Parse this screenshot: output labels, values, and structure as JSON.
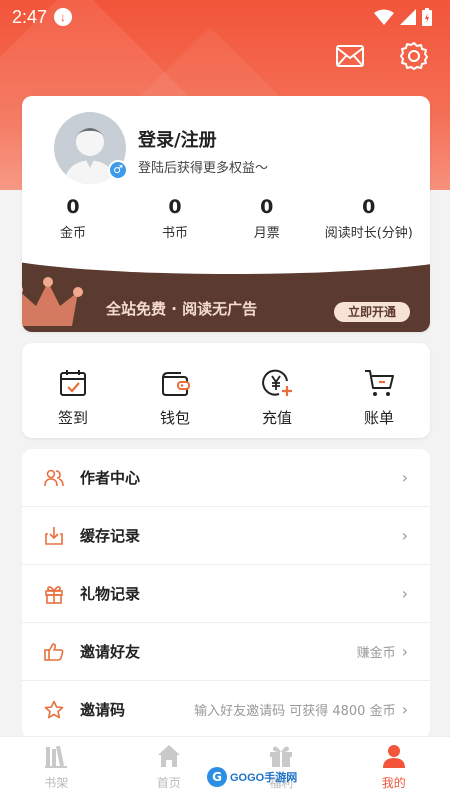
{
  "status_bar": {
    "time": "2:47"
  },
  "profile": {
    "login_title": "登录/注册",
    "login_subtitle": "登陆后获得更多权益～",
    "stats": [
      {
        "value": "0",
        "label": "金币"
      },
      {
        "value": "0",
        "label": "书币"
      },
      {
        "value": "0",
        "label": "月票"
      },
      {
        "value": "0",
        "label": "阅读时长(分钟)"
      }
    ]
  },
  "vip_banner": {
    "text": "全站免费 · 阅读无广告",
    "button": "立即开通"
  },
  "quick_actions": [
    {
      "label": "签到",
      "icon": "calendar-check-icon"
    },
    {
      "label": "钱包",
      "icon": "wallet-icon"
    },
    {
      "label": "充值",
      "icon": "yen-coin-plus-icon"
    },
    {
      "label": "账单",
      "icon": "cart-bill-icon"
    }
  ],
  "menu": [
    {
      "label": "作者中心",
      "hint": "",
      "icon": "users-icon"
    },
    {
      "label": "缓存记录",
      "hint": "",
      "icon": "download-icon"
    },
    {
      "label": "礼物记录",
      "hint": "",
      "icon": "gift-icon"
    },
    {
      "label": "邀请好友",
      "hint": "赚金币",
      "icon": "thumbs-up-icon"
    },
    {
      "label": "邀请码",
      "hint": "输入好友邀请码 可获得 4800 金币",
      "icon": "star-icon"
    }
  ],
  "tabbar": [
    {
      "label": "书架",
      "active": false
    },
    {
      "label": "首页",
      "active": false
    },
    {
      "label": "福利",
      "active": false
    },
    {
      "label": "我的",
      "active": true
    }
  ],
  "watermark": {
    "text": "GOGO手游网"
  },
  "colors": {
    "accent": "#f2553a",
    "vip_bg": "#5b3a30",
    "icon_orange": "#e8703f"
  }
}
